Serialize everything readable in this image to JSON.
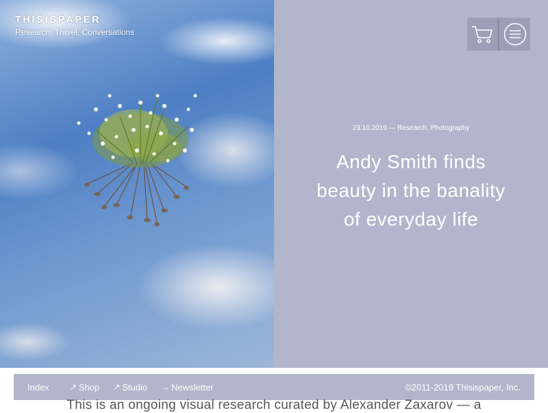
{
  "brand": {
    "name": "THISISPAPER",
    "tagline": "Research, Travel, Conversations"
  },
  "header": {
    "cart_icon": "cart-icon",
    "menu_icon": "menu-icon"
  },
  "article": {
    "date": "23.10.2019",
    "separator": "—",
    "category_1": "Research",
    "category_2": "Photography",
    "title": "Andy Smith finds beauty in the banality of everyday life"
  },
  "footer": {
    "index_label": "Index",
    "shop_label": "Shop",
    "studio_label": "Studio",
    "newsletter_label": "Newsletter",
    "external_arrow": "↗",
    "right_arrow": "→",
    "copyright": "©2011-2019 Thisispaper, Inc."
  },
  "intro_text": "This is an ongoing visual research curated by Alexander Zaxarov — a",
  "colors": {
    "panel": "#b2b6cc",
    "header_button_bg": "#9ba0b6",
    "text_light": "#ffffff"
  }
}
